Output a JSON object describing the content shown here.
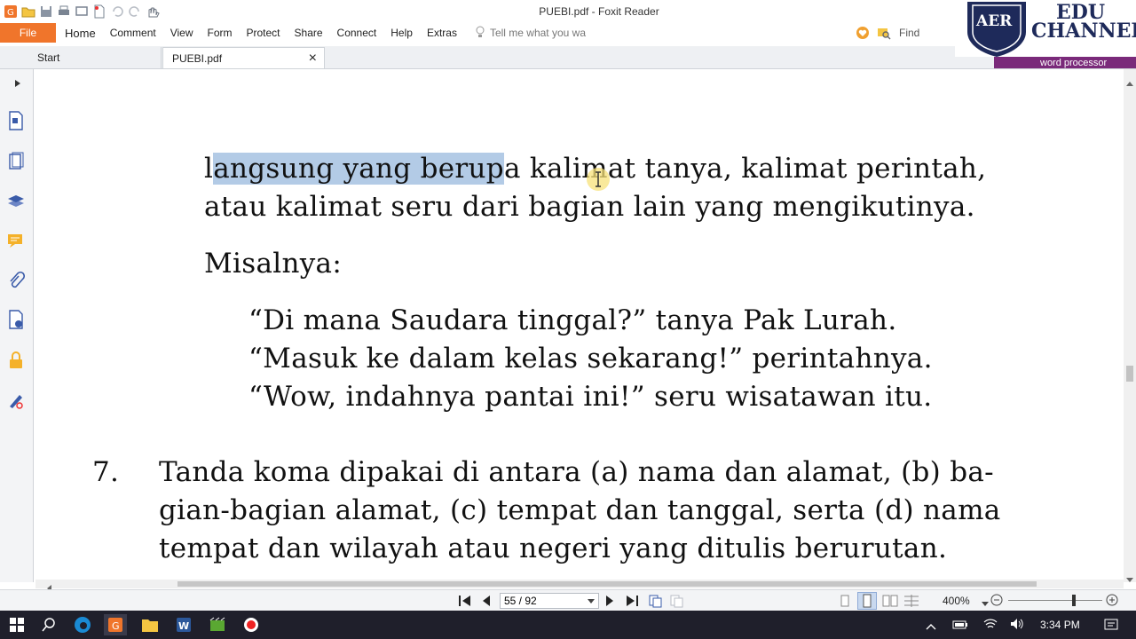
{
  "window": {
    "title": "PUEBI.pdf - Foxit Reader"
  },
  "menu": {
    "file": "File",
    "items": [
      "Home",
      "Comment",
      "View",
      "Form",
      "Protect",
      "Share",
      "Connect",
      "Help",
      "Extras"
    ],
    "tell_me_placeholder": "Tell me what you wa",
    "find_placeholder": "Find"
  },
  "tabs": [
    {
      "label": "Start"
    },
    {
      "label": "PUEBI.pdf",
      "close": "×"
    }
  ],
  "overlay": {
    "logo_initials": "AER",
    "logo_line1": "EDU",
    "logo_line2": "CHANNEL",
    "banner": "word processor"
  },
  "document": {
    "line1_pre": "l",
    "line1_highlight": "angsung yang berup",
    "line1_post": "a kalimat tanya, kalimat perintah,",
    "line2": "atau kalimat seru dari bagian lain yang mengikutinya.",
    "misalnya": "Misalnya:",
    "examples": [
      "“Di mana Saudara tinggal?” tanya Pak Lurah.",
      "“Masuk ke dalam kelas sekarang!” perintahnya.",
      "“Wow, indahnya pantai ini!” seru wisatawan itu."
    ],
    "item_number": "7.",
    "item_lines": [
      "Tanda koma dipakai di antara (a) nama dan alamat, (b) ba-",
      "gian-bagian alamat, (c) tempat dan tanggal, serta (d) nama",
      "tempat dan wilayah atau negeri yang ditulis berurutan."
    ]
  },
  "status": {
    "page": "55 / 92",
    "zoom": "400%"
  },
  "taskbar": {
    "time": "3:34 PM"
  },
  "colors": {
    "file_button": "#f0752b",
    "highlight": "#b3cbe6",
    "banner": "#7a2a7a",
    "taskbar": "#1f1f2b"
  }
}
